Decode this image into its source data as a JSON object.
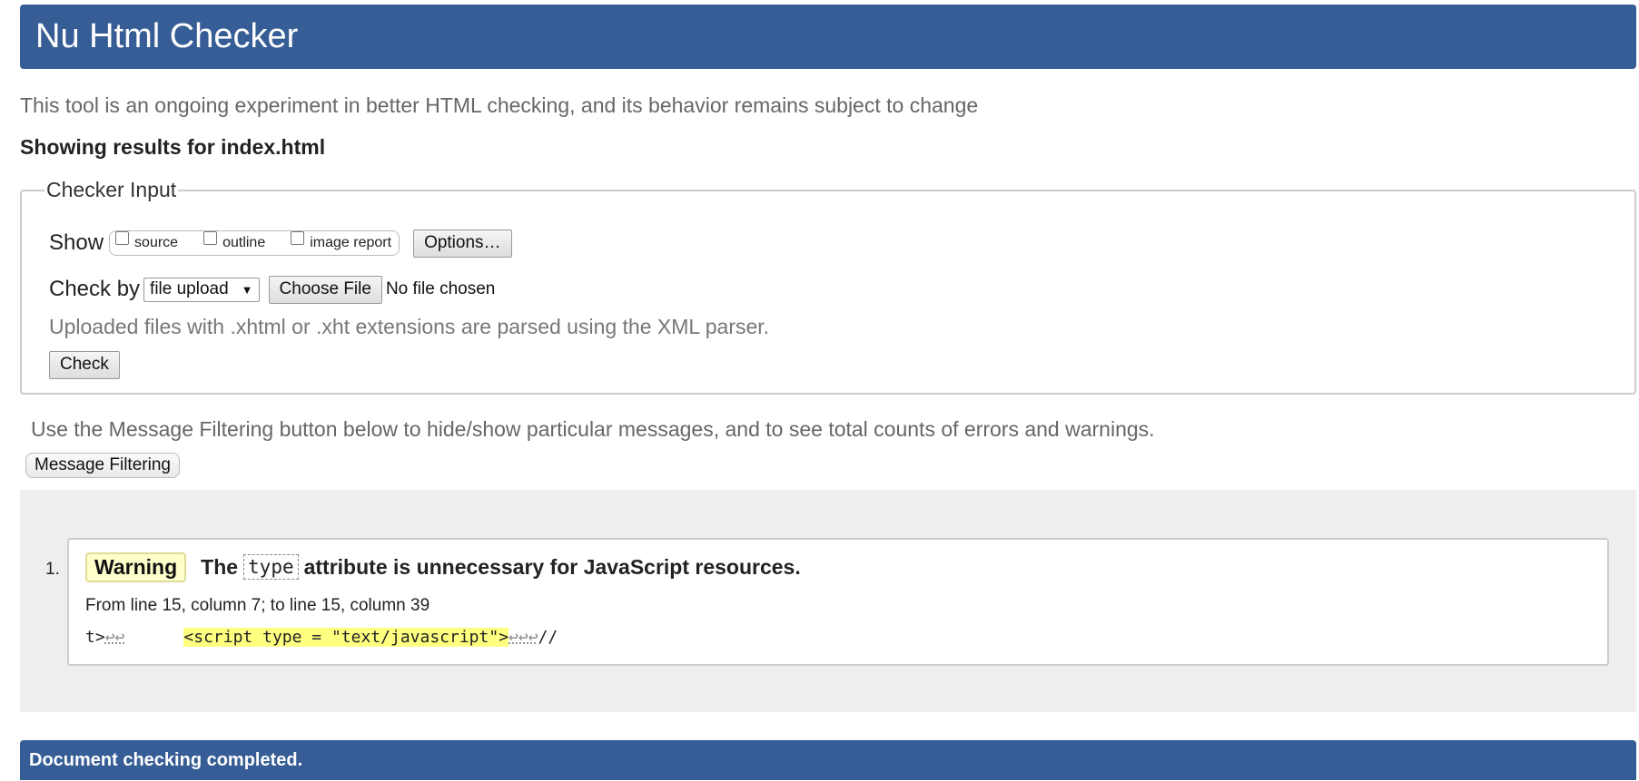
{
  "header": {
    "title": "Nu Html Checker"
  },
  "tagline": "This tool is an ongoing experiment in better HTML checking, and its behavior remains subject to change",
  "showing_results": "Showing results for index.html",
  "checker_input": {
    "legend": "Checker Input",
    "show_label": "Show",
    "show_options": [
      {
        "label": "source",
        "checked": false
      },
      {
        "label": "outline",
        "checked": false
      },
      {
        "label": "image report",
        "checked": false
      }
    ],
    "options_button": "Options…",
    "check_by_label": "Check by",
    "check_by_selected": "file upload",
    "choose_file_button": "Choose File",
    "file_status": "No file chosen",
    "upload_note": "Uploaded files with .xhtml or .xht extensions are parsed using the XML parser.",
    "check_button": "Check"
  },
  "filter_note": "Use the Message Filtering button below to hide/show particular messages, and to see total counts of errors and warnings.",
  "message_filtering_button": "Message Filtering",
  "results": [
    {
      "number": "1.",
      "type": "Warning",
      "message_before": "The",
      "message_code": "type",
      "message_after": "attribute is unnecessary for JavaScript resources.",
      "location": "From line 15, column 7; to line 15, column 39",
      "extract_prefix": "t>",
      "extract_prefix_returns": "↩↩",
      "extract_gap": "      ",
      "extract_highlight": "<script type = \"text/javascript\">",
      "extract_suffix_returns": "↩↩↩",
      "extract_suffix": "//"
    }
  ],
  "footer": {
    "status": "Document checking completed."
  },
  "colors": {
    "header_bg": "#365d95",
    "warning_badge_bg": "#ffffcc",
    "highlight": "#ffff80",
    "results_bg": "#eeeeee"
  }
}
